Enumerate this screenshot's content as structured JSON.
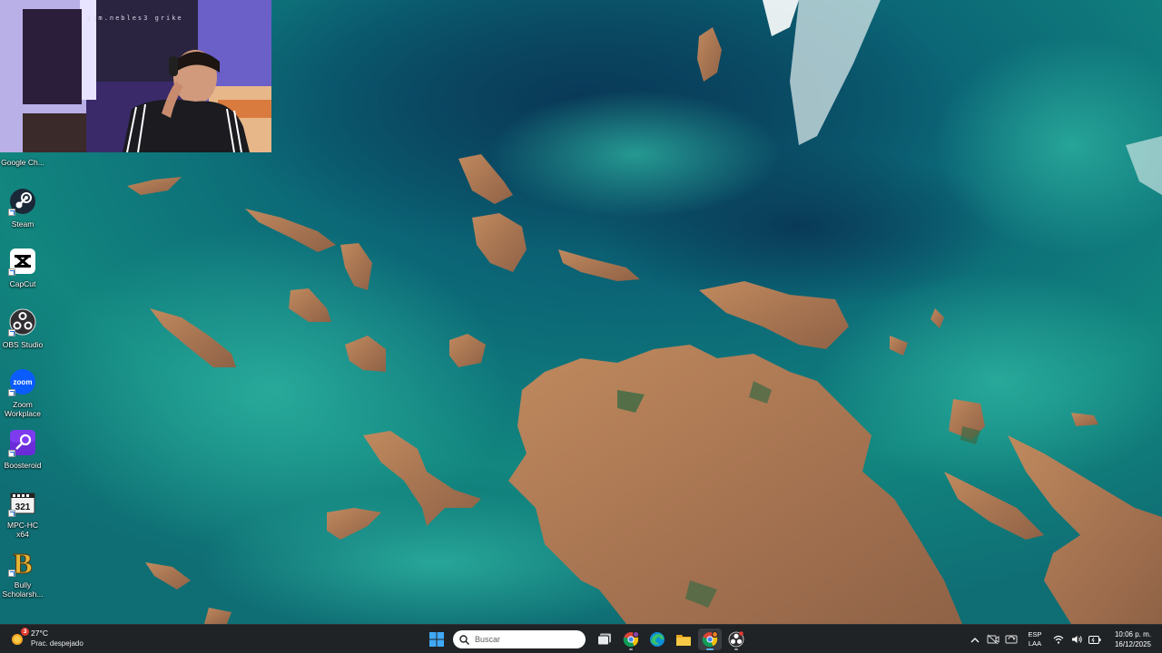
{
  "webcam": {
    "caption": "ggm.nebles3 grike"
  },
  "desktop": {
    "icons": [
      {
        "label": "Google Ch...",
        "icon": "google-chrome-icon"
      },
      {
        "label": "Steam",
        "icon": "steam-icon"
      },
      {
        "label": "CapCut",
        "icon": "capcut-icon"
      },
      {
        "label": "OBS Studio",
        "icon": "obs-icon"
      },
      {
        "label": "Zoom Workplace",
        "icon": "zoom-icon",
        "text": "zoom"
      },
      {
        "label": "Boosteroid",
        "icon": "boosteroid-icon"
      },
      {
        "label": "MPC-HC x64",
        "icon": "mpc-hc-icon",
        "text": "321"
      },
      {
        "label": "Bully Scholarsh...",
        "icon": "bully-icon",
        "text": "B"
      }
    ]
  },
  "taskbar": {
    "weather": {
      "temp": "27°C",
      "condition": "Prac. despejado",
      "badge": "3"
    },
    "search_placeholder": "Buscar",
    "apps": [
      {
        "name": "start-button",
        "icon": "windows-logo-icon"
      },
      {
        "name": "task-view",
        "icon": "task-view-icon"
      },
      {
        "name": "chrome-profile",
        "icon": "google-chrome-icon"
      },
      {
        "name": "edge",
        "icon": "microsoft-edge-icon"
      },
      {
        "name": "file-explorer",
        "icon": "folder-icon"
      },
      {
        "name": "chrome-active",
        "icon": "google-chrome-icon"
      },
      {
        "name": "obs",
        "icon": "obs-icon"
      }
    ],
    "tray": {
      "language_line1": "ESP",
      "language_line2": "LAA",
      "time": "10:06 p. m.",
      "date": "16/12/2025"
    }
  },
  "colors": {
    "taskbar_bg": "#202326",
    "sea": "#0e6a78",
    "land": "#b07a52",
    "accent": "#5fb2f2"
  }
}
